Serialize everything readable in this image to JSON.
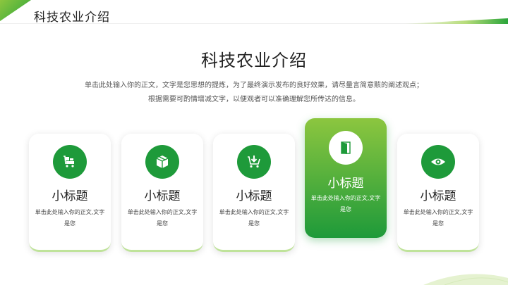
{
  "header": {
    "title": "科技农业介绍"
  },
  "main": {
    "title": "科技农业介绍",
    "description": "单击此处输入你的正文，文字是您思想的提炼，为了最终演示发布的良好效果，请尽量言简意赅的阐述观点；根据需要可酌情增减文字，以便观者可以准确理解您所传达的信息。"
  },
  "cards": [
    {
      "title": "小标题",
      "text": "单击此处输入你的正文,文字是您",
      "icon": "cart-boxes-icon"
    },
    {
      "title": "小标题",
      "text": "单击此处输入你的正文,文字是您",
      "icon": "package-icon"
    },
    {
      "title": "小标题",
      "text": "单击此处输入你的正文,文字是您",
      "icon": "download-cart-icon"
    },
    {
      "title": "小标题",
      "text": "单击此处输入你的正文,文字是您",
      "icon": "door-icon"
    },
    {
      "title": "小标题",
      "text": "单击此处输入你的正文,文字是您",
      "icon": "eye-icon"
    }
  ],
  "colors": {
    "accent": "#1e9a3a",
    "accent_light": "#8cc63f"
  }
}
